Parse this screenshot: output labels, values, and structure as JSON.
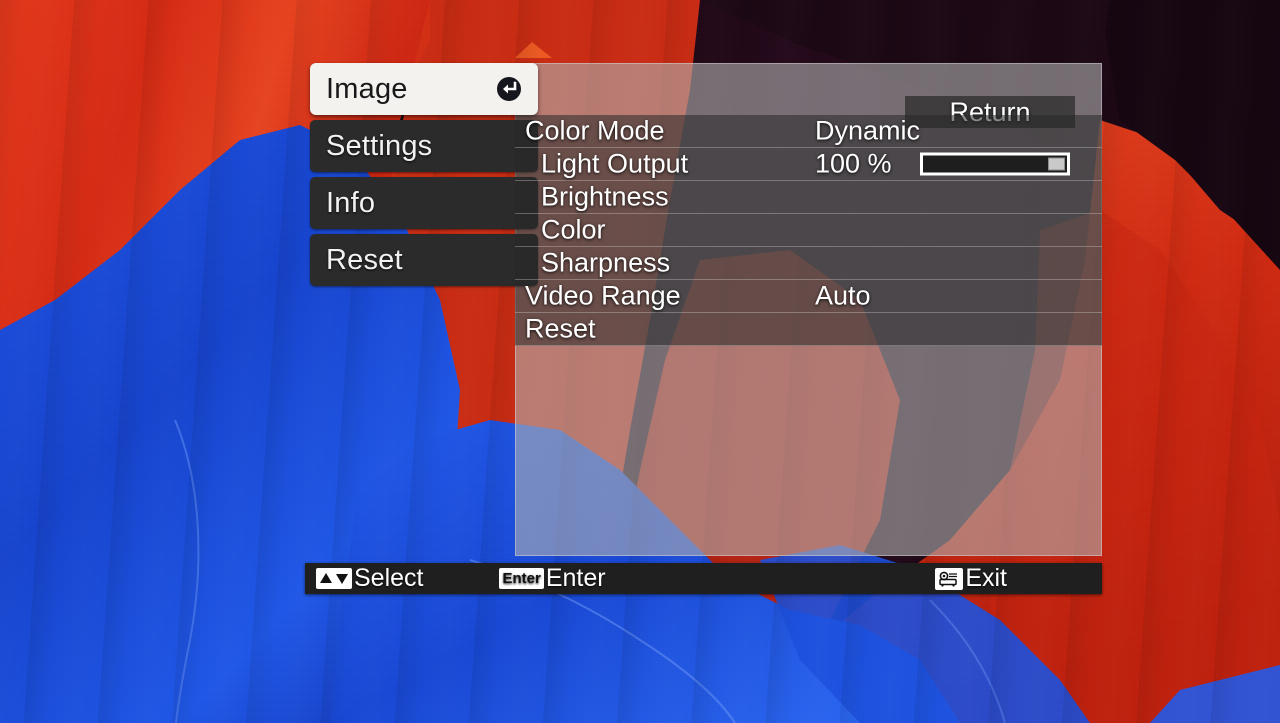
{
  "menu": {
    "tabs": [
      {
        "label": "Image",
        "active": true,
        "icon": "enter-return-icon"
      },
      {
        "label": "Settings",
        "active": false,
        "icon": ""
      },
      {
        "label": "Info",
        "active": false,
        "icon": ""
      },
      {
        "label": "Reset",
        "active": false,
        "icon": ""
      }
    ]
  },
  "panel": {
    "return_label": "Return",
    "rows": [
      {
        "label": "Color Mode",
        "value": "Dynamic",
        "indent": false,
        "slider": false
      },
      {
        "label": "Light Output",
        "value": "100 %",
        "indent": true,
        "slider": true,
        "slider_percent": 100
      },
      {
        "label": "Brightness",
        "value": "",
        "indent": true,
        "slider": false
      },
      {
        "label": "Color",
        "value": "",
        "indent": true,
        "slider": false
      },
      {
        "label": "Sharpness",
        "value": "",
        "indent": true,
        "slider": false
      },
      {
        "label": "Video Range",
        "value": "Auto",
        "indent": false,
        "slider": false
      },
      {
        "label": "Reset",
        "value": "",
        "indent": false,
        "slider": false
      }
    ]
  },
  "statusbar": {
    "select": {
      "label": "Select",
      "icon": "up-down-arrows-icon"
    },
    "enter": {
      "label": "Enter",
      "key": "Enter",
      "icon": "enter-key-icon"
    },
    "exit": {
      "label": "Exit",
      "icon": "projector-key-icon"
    }
  },
  "colors": {
    "red": "#e03317",
    "red_dark": "#b5200f",
    "blue": "#1649d8",
    "blue_light": "#2a62ee",
    "background_dark": "#1a0610",
    "panel": "#b0b0b0",
    "row": "#282828",
    "statusbar": "#1f1f1f",
    "tab_active": "#f3f2ee",
    "tab": "#2b2b2b"
  }
}
